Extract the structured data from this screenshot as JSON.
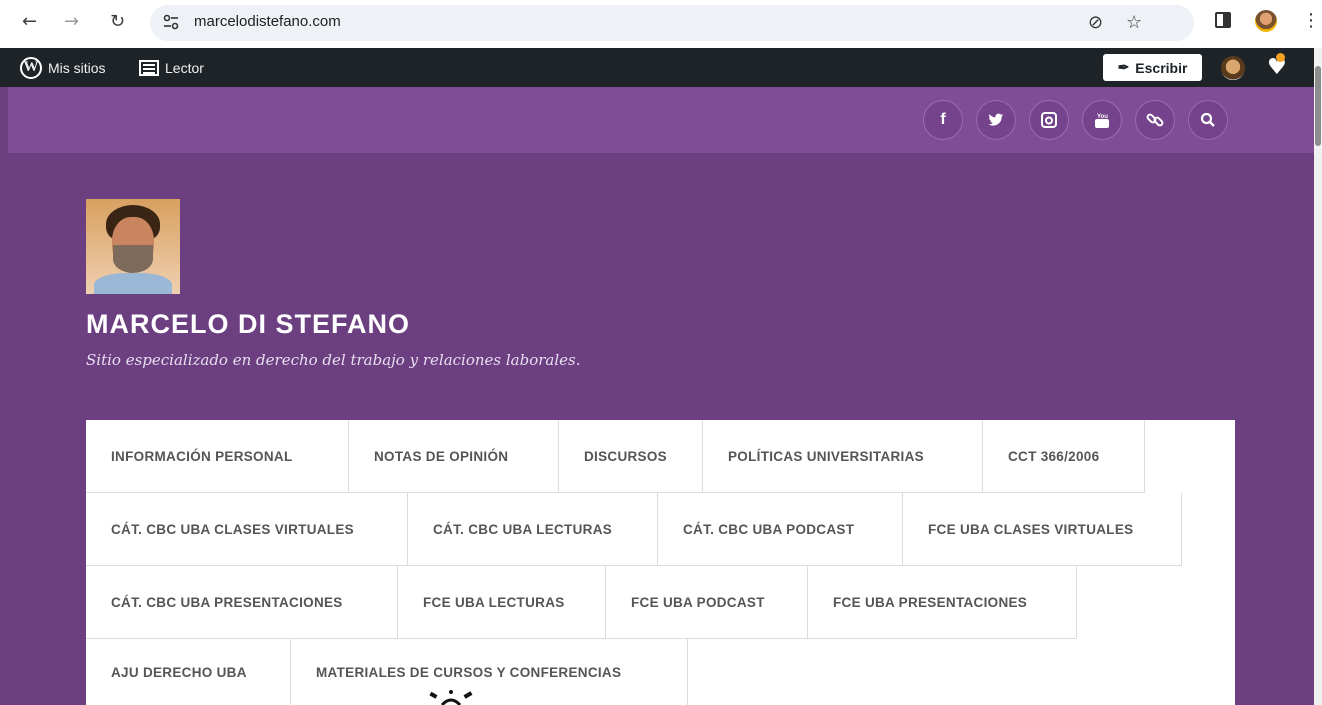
{
  "browser": {
    "url": "marcelodistefano.com"
  },
  "admin_bar": {
    "my_sites": "Mis sitios",
    "reader": "Lector",
    "write": "Escribir"
  },
  "social_icons": [
    "facebook-icon",
    "twitter-icon",
    "instagram-icon",
    "youtube-icon",
    "link-icon",
    "search-icon"
  ],
  "site": {
    "title": "MARCELO DI STEFANO",
    "description": "Sitio especializado en derecho del trabajo y relaciones laborales."
  },
  "menu": {
    "rows": [
      [
        "INFORMACIÓN PERSONAL",
        "NOTAS DE OPINIÓN",
        "DISCURSOS",
        "POLÍTICAS UNIVERSITARIAS",
        "CCT 366/2006"
      ],
      [
        "CÁT. CBC UBA CLASES VIRTUALES",
        "CÁT. CBC UBA LECTURAS",
        "CÁT. CBC UBA PODCAST",
        "FCE UBA CLASES VIRTUALES"
      ],
      [
        "CÁT. CBC UBA PRESENTACIONES",
        "FCE UBA LECTURAS",
        "FCE UBA PODCAST",
        "FCE UBA PRESENTACIONES"
      ],
      [
        "AJU DERECHO UBA",
        "MATERIALES DE CURSOS Y CONFERENCIAS"
      ]
    ]
  },
  "colors": {
    "header_bg": "#6b3f80",
    "social_bar_bg": "#7e4d95",
    "admin_bar_bg": "#1d2327"
  }
}
